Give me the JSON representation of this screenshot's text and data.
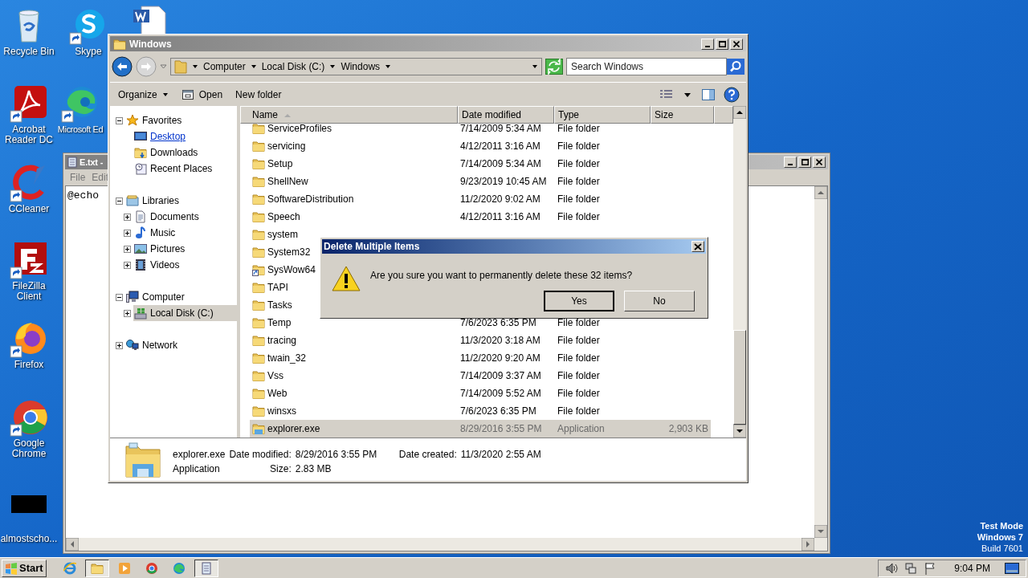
{
  "desktop_icons": [
    {
      "label": "Recycle Bin"
    },
    {
      "label": "Skype"
    },
    {
      "label": "Acrobat Reader DC"
    },
    {
      "label": "Microsoft Ed"
    },
    {
      "label": "CCleaner"
    },
    {
      "label": "FileZilla Client"
    },
    {
      "label": "Firefox"
    },
    {
      "label": "Google Chrome"
    },
    {
      "label": "almostscho..."
    }
  ],
  "notepad": {
    "title": "E.txt -",
    "menu": [
      "File",
      "Edit"
    ],
    "text": "@echo"
  },
  "explorer": {
    "title": "Windows",
    "breadcrumb": [
      "Computer",
      "Local Disk (C:)",
      "Windows"
    ],
    "search": {
      "placeholder": "Search Windows"
    },
    "toolbar": [
      {
        "label": "Organize",
        "kind": "menu"
      },
      {
        "label": "Open",
        "kind": "open"
      },
      {
        "label": "New folder",
        "kind": "plain"
      }
    ],
    "nav_tree": [
      {
        "label": "Favorites",
        "expanded": true,
        "selected": false,
        "hovered": false,
        "children": [
          {
            "label": "Desktop",
            "selected": false,
            "hovered": true
          },
          {
            "label": "Downloads",
            "selected": false,
            "hovered": false
          },
          {
            "label": "Recent Places",
            "selected": false,
            "hovered": false
          }
        ]
      },
      {
        "label": "Libraries",
        "expanded": true,
        "selected": false,
        "hovered": false,
        "children": [
          {
            "label": "Documents",
            "expanded": false,
            "selected": false,
            "hovered": false
          },
          {
            "label": "Music",
            "expanded": false,
            "selected": false,
            "hovered": false
          },
          {
            "label": "Pictures",
            "expanded": false,
            "selected": false,
            "hovered": false
          },
          {
            "label": "Videos",
            "expanded": false,
            "selected": false,
            "hovered": false
          }
        ]
      },
      {
        "label": "Computer",
        "expanded": true,
        "selected": false,
        "hovered": false,
        "children": [
          {
            "label": "Local Disk (C:)",
            "expanded": false,
            "selected": true,
            "hovered": false
          }
        ]
      },
      {
        "label": "Network",
        "expanded": false,
        "selected": false,
        "hovered": false
      }
    ],
    "columns": [
      {
        "label": "Name",
        "sorted": true
      },
      {
        "label": "Date modified",
        "sorted": false
      },
      {
        "label": "Type",
        "sorted": false
      },
      {
        "label": "Size",
        "sorted": false
      }
    ],
    "rows": [
      {
        "kind": "folder",
        "name": "ServiceProfiles",
        "date_modified": "7/14/2009 5:34 AM",
        "type": "File folder",
        "selected": false
      },
      {
        "kind": "folder",
        "name": "servicing",
        "date_modified": "4/12/2011 3:16 AM",
        "type": "File folder",
        "selected": false
      },
      {
        "kind": "folder",
        "name": "Setup",
        "date_modified": "7/14/2009 5:34 AM",
        "type": "File folder",
        "selected": false
      },
      {
        "kind": "folder",
        "name": "ShellNew",
        "date_modified": "9/23/2019 10:45 AM",
        "type": "File folder",
        "selected": false
      },
      {
        "kind": "folder",
        "name": "SoftwareDistribution",
        "date_modified": "11/2/2020 9:02 AM",
        "type": "File folder",
        "selected": false
      },
      {
        "kind": "folder",
        "name": "Speech",
        "date_modified": "4/12/2011 3:16 AM",
        "type": "File folder",
        "selected": false
      },
      {
        "kind": "folder",
        "name": "system",
        "selected": false
      },
      {
        "kind": "folder",
        "name": "System32",
        "selected": false
      },
      {
        "kind": "link",
        "name": "SysWow64",
        "selected": false
      },
      {
        "kind": "folder",
        "name": "TAPI",
        "selected": false
      },
      {
        "kind": "folder",
        "name": "Tasks",
        "selected": false
      },
      {
        "kind": "folder",
        "name": "Temp",
        "date_modified": "7/6/2023 6:35 PM",
        "type": "File folder",
        "selected": false
      },
      {
        "kind": "folder",
        "name": "tracing",
        "date_modified": "11/3/2020 3:18 AM",
        "type": "File folder",
        "selected": false
      },
      {
        "kind": "folder",
        "name": "twain_32",
        "date_modified": "11/2/2020 9:20 AM",
        "type": "File folder",
        "selected": false
      },
      {
        "kind": "folder",
        "name": "Vss",
        "date_modified": "7/14/2009 3:37 AM",
        "type": "File folder",
        "selected": false
      },
      {
        "kind": "folder",
        "name": "Web",
        "date_modified": "7/14/2009 5:52 AM",
        "type": "File folder",
        "selected": false
      },
      {
        "kind": "folder",
        "name": "winsxs",
        "date_modified": "7/6/2023 6:35 PM",
        "type": "File folder",
        "selected": false
      },
      {
        "kind": "app",
        "name": "explorer.exe",
        "date_modified": "8/29/2016 3:55 PM",
        "type": "Application",
        "size": "2,903 KB",
        "selected": true
      }
    ],
    "details": {
      "name": "explorer.exe",
      "type": "Application",
      "modified": {
        "label": "Date modified:",
        "value": "8/29/2016 3:55 PM"
      },
      "created": {
        "label": "Date created:",
        "value": "11/3/2020 2:55 AM"
      },
      "size": {
        "label": "Size:",
        "value": "2.83 MB"
      }
    }
  },
  "dialog": {
    "title": "Delete Multiple Items",
    "message": "Are you sure you want to permanently delete these 32 items?",
    "buttons": [
      {
        "label": "Yes",
        "default": true
      },
      {
        "label": "No",
        "default": false
      }
    ]
  },
  "taskbar": {
    "start": "Start",
    "apps": [
      {
        "active": false
      },
      {
        "active": true
      },
      {
        "active": false
      },
      {
        "active": false
      },
      {
        "active": false
      },
      {
        "active": true
      }
    ],
    "clock": "9:04 PM"
  },
  "system_notice": [
    "Test Mode",
    "Windows 7",
    "Build 7601"
  ]
}
